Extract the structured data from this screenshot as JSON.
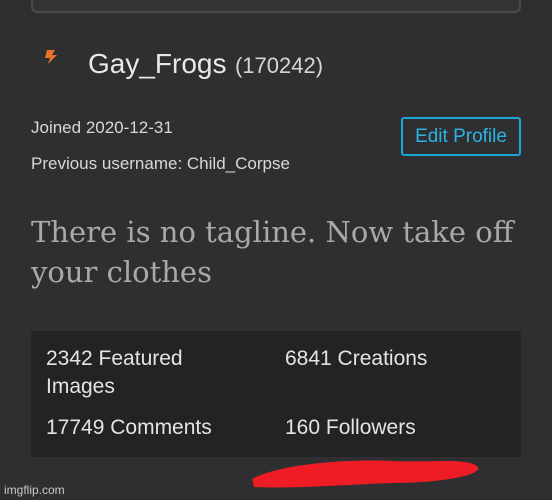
{
  "profile": {
    "username": "Gay_Frogs",
    "user_id": "(170242)",
    "joined": "Joined 2020-12-31",
    "previous_username": "Previous username: Child_Corpse",
    "edit_profile_label": "Edit Profile",
    "tagline": "There is no tagline. Now take off your clothes"
  },
  "stats": {
    "featured_images": "2342 Featured Images",
    "creations": "6841 Creations",
    "comments": "17749 Comments",
    "followers": "160 Followers"
  },
  "annotation": {
    "underline_color": "#ee1c25"
  },
  "watermark": "imgflip.com",
  "colors": {
    "background": "#2f2f31",
    "accent": "#1aa6d6",
    "logo": "#e8742a"
  }
}
